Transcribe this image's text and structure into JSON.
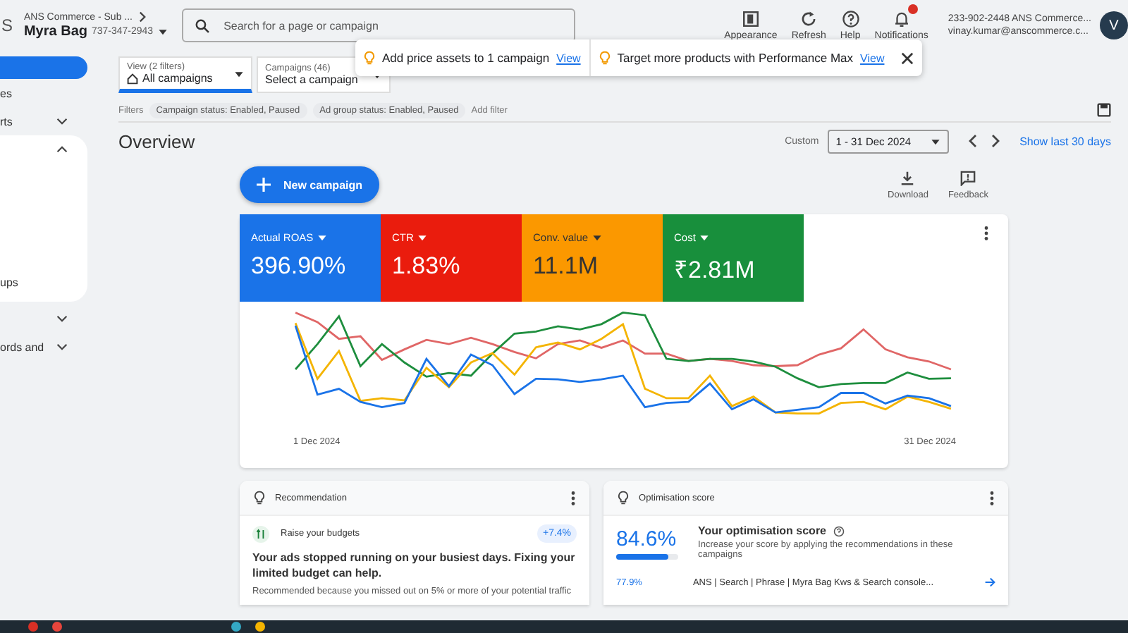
{
  "header": {
    "logo_fragment": "S",
    "account_path": "ANS Commerce - Sub ...",
    "account_name": "Myra Bag",
    "account_id": "737-347-2943",
    "search": {
      "placeholder": "Search for a page or campaign"
    },
    "tools": [
      {
        "kind": "appearance",
        "label": "Appearance"
      },
      {
        "kind": "refresh",
        "label": "Refresh"
      },
      {
        "kind": "help",
        "label": "Help"
      },
      {
        "kind": "bell",
        "label": "Notifications",
        "badge": true
      }
    ],
    "user": {
      "line_1": "233-902-2448 ANS Commerce...",
      "line_2": "vinay.kumar@anscommerce.c...",
      "avatar": "V"
    }
  },
  "sidebar": {
    "items": [
      {
        "kind": "pill",
        "selected": true
      },
      {
        "kind": "link",
        "label": "es"
      },
      {
        "kind": "section",
        "label": "rts",
        "expanded": false
      },
      {
        "kind": "section",
        "expanded": true,
        "children": [
          {
            "label": "ups"
          }
        ]
      },
      {
        "kind": "section",
        "expanded": false
      },
      {
        "kind": "section",
        "label": "ords and",
        "expanded": false
      }
    ]
  },
  "views": [
    {
      "kind": "view",
      "caption": "View (2 filters)",
      "value": "All campaigns",
      "selected": true
    },
    {
      "kind": "campaign",
      "caption": "Campaigns (46)",
      "value": "Select a campaign",
      "selected": false
    }
  ],
  "suggestions": [
    {
      "text": "Add price assets to 1 campaign",
      "link": "View"
    },
    {
      "text": "Target more products with Performance Max",
      "link": "View"
    }
  ],
  "filters": {
    "label": "Filters",
    "chips": [
      "Campaign status: Enabled, Paused",
      "Ad group status: Enabled, Paused"
    ],
    "add": "Add filter"
  },
  "overview": {
    "title": "Overview",
    "range_label": "Custom",
    "range": "1 - 31 Dec 2024",
    "quick": "Show last 30 days"
  },
  "actions": {
    "new_campaign": "New campaign",
    "tools": [
      {
        "kind": "download",
        "label": "Download"
      },
      {
        "kind": "feedback",
        "label": "Feedback"
      }
    ]
  },
  "metrics": [
    {
      "label": "Actual ROAS",
      "value": "396.90%",
      "color": "#1a73e8"
    },
    {
      "label": "CTR",
      "value": "1.83%",
      "color": "#ea1c0d"
    },
    {
      "label": "Conv. value",
      "value": "11.1M",
      "color": "#fb9800"
    },
    {
      "label": "Cost",
      "value": "₹2.81M",
      "color": "#188f3c"
    }
  ],
  "chart": {
    "x_start": "1 Dec 2024",
    "x_end": "31 Dec 2024"
  },
  "recommendation": {
    "title": "Recommendation",
    "item": "Raise your budgets",
    "badge": "+7.4%",
    "headline": "Your ads stopped running on your busiest days. Fixing your limited budget can help.",
    "detail": "Recommended because you missed out on 5% or more of your potential traffic"
  },
  "optimisation": {
    "title": "Optimisation score",
    "score": "84.6%",
    "level": 0.846,
    "heading": "Your optimisation score",
    "text": "Increase your score by applying the recommendations in these campaigns",
    "campaigns": [
      {
        "score": "77.9%",
        "name": "ANS | Search | Phrase | Myra Bag Kws & Search console..."
      }
    ]
  }
}
